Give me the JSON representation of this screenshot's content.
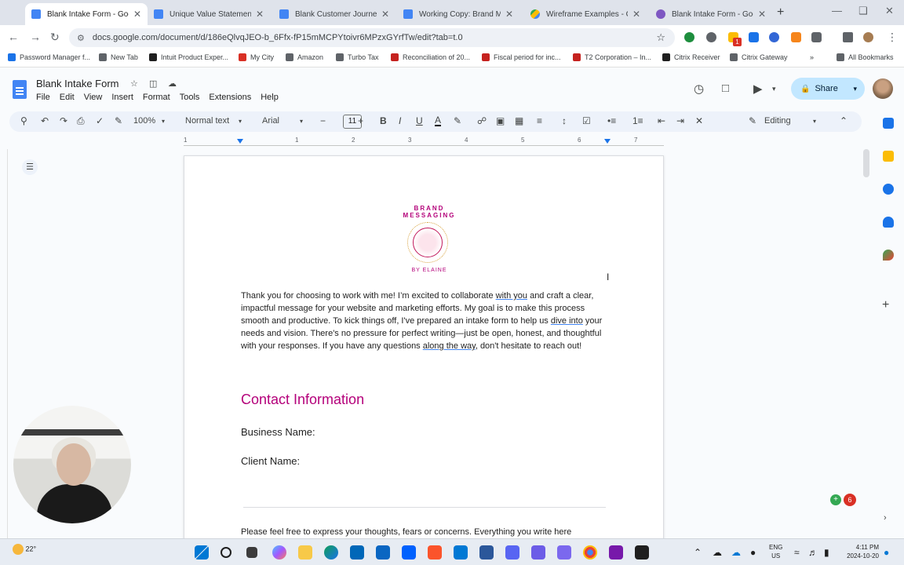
{
  "browser": {
    "tabs": [
      {
        "label": "Blank Intake Form - Goog",
        "fav": "doc",
        "active": true
      },
      {
        "label": "Unique Value Statement | T",
        "fav": "doc",
        "active": false
      },
      {
        "label": "Blank Customer Journey Te",
        "fav": "doc",
        "active": false
      },
      {
        "label": "Working Copy: Brand Mess",
        "fav": "doc",
        "active": false
      },
      {
        "label": "Wireframe Examples - Goo",
        "fav": "drive",
        "active": false
      },
      {
        "label": "Blank Intake Form - Goog",
        "fav": "gear",
        "active": false
      }
    ],
    "url": "docs.google.com/document/d/186eQlvqJEO-b_6Ffx-fP15mMCPYtoivr6MPzxGYrfTw/edit?tab=t.0",
    "extension_badge": "1",
    "bookmarks": [
      "Password Manager f...",
      "New Tab",
      "Intuit Product Exper...",
      "My City",
      "Amazon",
      "Turbo Tax",
      "Reconciliation of 20...",
      "Fiscal period for inc...",
      "T2 Corporation – In...",
      "Citrix Receiver",
      "Citrix Gateway"
    ],
    "all_bookmarks": "All Bookmarks"
  },
  "docs": {
    "title": "Blank Intake Form",
    "menu": [
      "File",
      "Edit",
      "View",
      "Insert",
      "Format",
      "Tools",
      "Extensions",
      "Help"
    ],
    "share_label": "Share",
    "toolbar": {
      "zoom": "100%",
      "style": "Normal text",
      "font": "Arial",
      "size": "11",
      "mode": "Editing"
    },
    "ruler_ticks": [
      "1",
      "1",
      "2",
      "3",
      "4",
      "5",
      "6",
      "7"
    ]
  },
  "document": {
    "logo_top": "BRAND MESSAGING",
    "logo_bottom": "BY ELAINE",
    "intro": [
      {
        "t": "Thank you for choosing to work with me! I’m excited to collaborate ",
        "u": false
      },
      {
        "t": "with you",
        "u": true
      },
      {
        "t": " and craft a clear, impactful message for your website and marketing efforts. My goal is to make this process smooth and productive. To kick things off, I've prepared an intake form to help us ",
        "u": false
      },
      {
        "t": "dive into",
        "u": true
      },
      {
        "t": " your needs and vision. There's no pressure for perfect writing—just be open, honest, and thoughtful with your responses. If you have any questions ",
        "u": false
      },
      {
        "t": "along the way",
        "u": true
      },
      {
        "t": ", don't hesitate to reach out!",
        "u": false
      }
    ],
    "contact_heading": "Contact Information",
    "business_name_label": "Business Name:",
    "client_name_label": "Client Name:",
    "tail_text": "Please feel free to express your thoughts, fears or concerns.  Everything you write here"
  },
  "badge_count": "6",
  "taskbar": {
    "temperature": "22°",
    "lang_line1": "ENG",
    "lang_line2": "US",
    "time": "4:11 PM",
    "date": "2024-10-20"
  }
}
